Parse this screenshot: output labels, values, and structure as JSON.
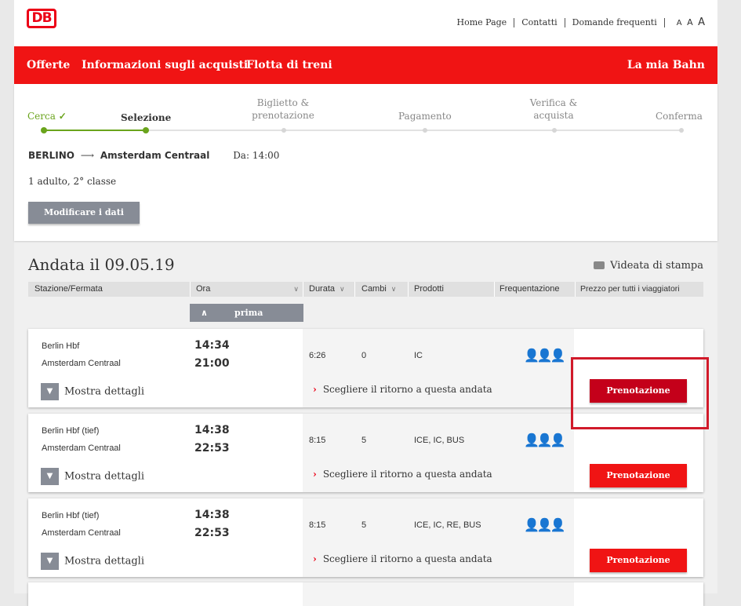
{
  "header": {
    "links": [
      "Home Page",
      "Contatti",
      "Domande frequenti"
    ],
    "font_sizes": [
      "A",
      "A",
      "A"
    ]
  },
  "nav": {
    "items": [
      "Offerte",
      "Informazioni sugli acquisti",
      "Flotta di treni"
    ],
    "account": "La mia Bahn"
  },
  "progress": {
    "steps": [
      {
        "label": "Cerca",
        "state": "done"
      },
      {
        "label": "Selezione",
        "state": "active"
      },
      {
        "label": "Biglietto & prenotazione",
        "state": "pending"
      },
      {
        "label": "Pagamento",
        "state": "pending"
      },
      {
        "label": "Verifica & acquista",
        "state": "pending"
      },
      {
        "label": "Conferma",
        "state": "pending"
      }
    ],
    "done_color": "#6aa41c"
  },
  "search": {
    "from": "BERLINO",
    "to": "Amsterdam Centraal",
    "departure": "Da: 14:00",
    "passengers": "1 adulto, 2° classe",
    "modify_label": "Modificare i dati"
  },
  "results": {
    "title": "Andata il 09.05.19",
    "print_label": "Videata di stampa",
    "columns": [
      "Stazione/Fermata",
      "Ora",
      "Durata",
      "Cambi",
      "Prodotti",
      "Frequentazione",
      "Prezzo per tutti i viaggiatori"
    ],
    "earlier_label": "prima",
    "details_label": "Mostra dettagli",
    "return_label": "Scegliere il ritorno a questa andata",
    "book_label": "Prenotazione",
    "connections": [
      {
        "from": "Berlin Hbf",
        "to": "Amsterdam Centraal",
        "dep": "14:34",
        "arr": "21:00",
        "duration": "6:26",
        "changes": "0",
        "products": "IC",
        "occupancy": "low",
        "occupancy_color": "#888888"
      },
      {
        "from": "Berlin Hbf (tief)",
        "to": "Amsterdam Centraal",
        "dep": "14:38",
        "arr": "22:53",
        "duration": "8:15",
        "changes": "5",
        "products": "ICE, IC, BUS",
        "occupancy": "high",
        "occupancy_color": "#f39200"
      },
      {
        "from": "Berlin Hbf (tief)",
        "to": "Amsterdam Centraal",
        "dep": "14:38",
        "arr": "22:53",
        "duration": "8:15",
        "changes": "5",
        "products": "ICE, IC, RE, BUS",
        "occupancy": "high",
        "occupancy_color": "#f39200"
      }
    ]
  },
  "colors": {
    "db_red": "#f01414",
    "highlight": "#d11a2a"
  }
}
